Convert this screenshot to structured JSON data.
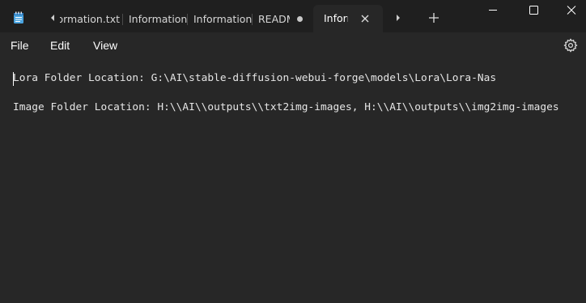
{
  "titlebar": {
    "app_icon": "notepad-icon",
    "tabs": [
      {
        "label": "Information.txt"
      },
      {
        "label": "Information.txt"
      },
      {
        "label": "Information.txt"
      },
      {
        "label": "README.md"
      }
    ],
    "active_tab": {
      "label": "Information.txt"
    },
    "scroll_left_icon": "caret-left-icon",
    "scroll_right_icon": "caret-right-icon",
    "new_tab_icon": "plus-icon",
    "window_buttons": [
      "minimize-icon",
      "maximize-icon",
      "close-icon"
    ]
  },
  "menu": {
    "file": "File",
    "edit": "Edit",
    "view": "View",
    "settings_icon": "gear-icon"
  },
  "editor": {
    "lines": [
      "Lora Folder Location: G:\\AI\\stable-diffusion-webui-forge\\models\\Lora\\Lora-Nas",
      "Image Folder Location: H:\\\\AI\\\\outputs\\\\txt2img-images, H:\\\\AI\\\\outputs\\\\img2img-images"
    ]
  },
  "colors": {
    "titlebar_bg": "#1f1f1f",
    "editor_bg": "#272727",
    "text": "#e6e6e6",
    "modified_dot": "#c8c8c8"
  }
}
